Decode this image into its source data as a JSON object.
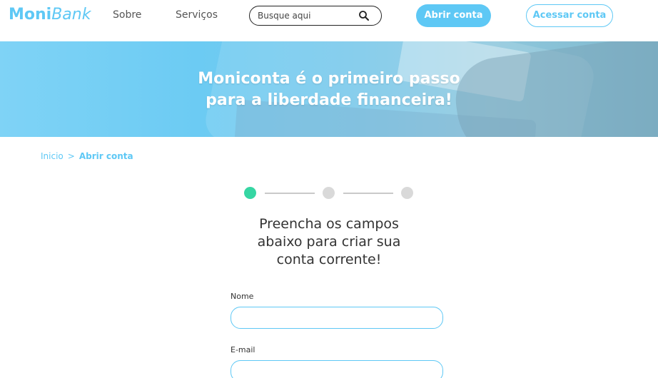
{
  "header": {
    "logo": {
      "bold": "Moni",
      "italic": "Bank"
    },
    "nav": [
      {
        "label": "Sobre"
      },
      {
        "label": "Serviços"
      }
    ],
    "search": {
      "placeholder": "Busque aqui",
      "icon": "search-icon"
    },
    "open_account_label": "Abrir conta",
    "login_label": "Acessar conta"
  },
  "hero": {
    "title_line1": "Moniconta é o primeiro passo",
    "title_line2": "para a liberdade financeira!"
  },
  "breadcrumb": {
    "home": "Inicio",
    "separator": ">",
    "current": "Abrir conta"
  },
  "stepper": {
    "total_steps": 3,
    "current_step": 1,
    "active_color": "#36d6a3",
    "inactive_color": "#d9d9d9"
  },
  "form": {
    "title_line1": "Preencha os campos",
    "title_line2": "abaixo para criar sua",
    "title_line3": "conta corrente!",
    "fields": [
      {
        "label": "Nome",
        "value": ""
      },
      {
        "label": "E-mail",
        "value": ""
      }
    ]
  },
  "colors": {
    "brand": "#5ec8f5",
    "accent_green": "#36d6a3"
  }
}
